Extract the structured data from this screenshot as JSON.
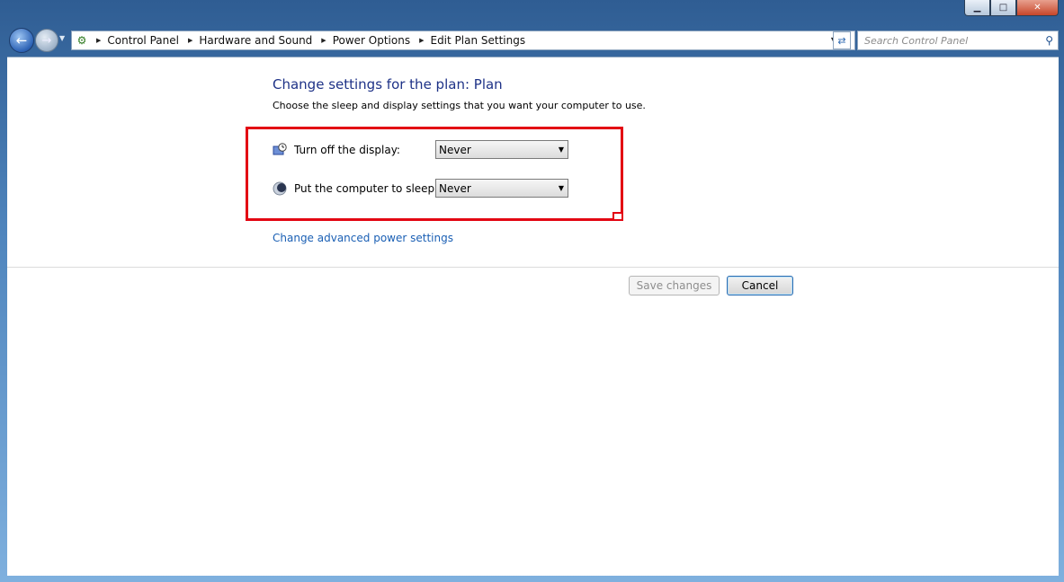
{
  "window": {
    "controls": {
      "minimize": "▁",
      "maximize": "□",
      "close": "✕"
    }
  },
  "navbar": {
    "breadcrumbs": [
      "Control Panel",
      "Hardware and Sound",
      "Power Options",
      "Edit Plan Settings"
    ],
    "search_placeholder": "Search Control Panel"
  },
  "main": {
    "title": "Change settings for the plan: Plan",
    "subtitle": "Choose the sleep and display settings that you want your computer to use.",
    "settings": [
      {
        "label": "Turn off the display:",
        "value": "Never",
        "icon": "display-timer-icon"
      },
      {
        "label": "Put the computer to sleep:",
        "value": "Never",
        "icon": "sleep-moon-icon"
      }
    ],
    "advanced_link": "Change advanced power settings",
    "save_label": "Save changes",
    "cancel_label": "Cancel"
  },
  "colors": {
    "highlight": "#e30613",
    "title": "#1e3287",
    "link": "#1a5fb4"
  }
}
